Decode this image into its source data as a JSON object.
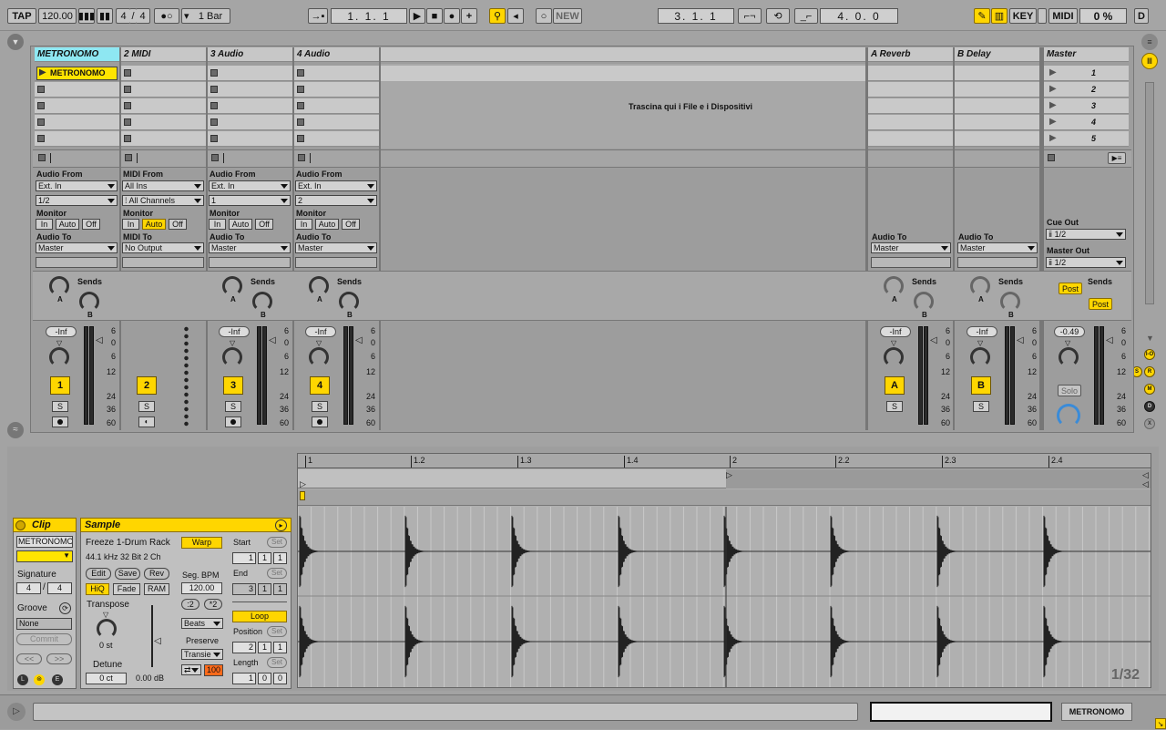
{
  "transport": {
    "tap": "TAP",
    "tempo": "120.00",
    "signature_num": "4",
    "signature_den": "4",
    "quantize": "1 Bar",
    "position": "1.   1.   1",
    "new": "NEW",
    "loop_start": "3.   1.   1",
    "loop_length": "4.   0.   0",
    "key": "KEY",
    "midi": "MIDI",
    "cpu": "0 %",
    "disk": "D"
  },
  "tracks": [
    {
      "name": "METRONOMO",
      "clip": "METRONOMO",
      "number": "1"
    },
    {
      "name": "2 MIDI",
      "number": "2"
    },
    {
      "name": "3 Audio",
      "number": "3"
    },
    {
      "name": "4 Audio",
      "number": "4"
    }
  ],
  "returns": [
    {
      "name": "A Reverb",
      "letter": "A"
    },
    {
      "name": "B Delay",
      "letter": "B"
    }
  ],
  "master": {
    "name": "Master",
    "scenes": [
      "1",
      "2",
      "3",
      "4",
      "5"
    ],
    "cue_out_label": "Cue Out",
    "cue_out": "1/2",
    "master_out_label": "Master Out",
    "master_out": "1/2",
    "post": "Post",
    "volume": "-0.49",
    "solo": "Solo"
  },
  "drop_hint": "Trascina qui i File e i Dispositivi",
  "io": {
    "audio_from": "Audio From",
    "midi_from": "MIDI From",
    "monitor": "Monitor",
    "audio_to": "Audio To",
    "midi_to": "MIDI To",
    "in": "In",
    "auto": "Auto",
    "off": "Off",
    "ext_in": "Ext. In",
    "all_ins": "All Ins",
    "all_channels": "All Channels",
    "ch1": "1/2",
    "ch3": "1",
    "ch4": "2",
    "master": "Master",
    "no_output": "No Output"
  },
  "mixer": {
    "sends": "Sends",
    "send_a": "A",
    "send_b": "B",
    "inf": "-Inf",
    "solo_s": "S",
    "scale": [
      "6",
      "0",
      "6",
      "12",
      "24",
      "36",
      "60"
    ]
  },
  "clip_panel": {
    "title": "Clip",
    "name": "METRONOMO",
    "signature_label": "Signature",
    "sig_num": "4",
    "sig_den": "4",
    "groove_label": "Groove",
    "groove": "None",
    "commit": "Commit",
    "prev": "<<",
    "next": ">>"
  },
  "sample_panel": {
    "title": "Sample",
    "name": "Freeze 1-Drum Rack",
    "info": "44.1 kHz 32 Bit 2 Ch",
    "edit": "Edit",
    "save": "Save",
    "rev": "Rev",
    "hiq": "HiQ",
    "fade": "Fade",
    "ram": "RAM",
    "transpose": "Transpose",
    "transpose_val": "0 st",
    "detune": "Detune",
    "detune_val": "0 ct",
    "gain": "0.00 dB",
    "warp": "Warp",
    "seg_bpm_label": "Seg. BPM",
    "seg_bpm": "120.00",
    "half": ":2",
    "double": "*2",
    "warp_mode": "Beats",
    "preserve_label": "Preserve",
    "preserve": "Transie",
    "envelope": "100",
    "start": "Start",
    "end": "End",
    "loop": "Loop",
    "position": "Position",
    "length": "Length",
    "set": "Set",
    "start_vals": [
      "1",
      "1",
      "1"
    ],
    "end_vals": [
      "3",
      "1",
      "1"
    ],
    "pos_vals": [
      "2",
      "1",
      "1"
    ],
    "len_vals": [
      "1",
      "0",
      "0"
    ]
  },
  "ruler": [
    "1",
    "1.2",
    "1.3",
    "1.4",
    "2",
    "2.2",
    "2.3",
    "2.4"
  ],
  "zoom": "1/32",
  "status_track": "METRONOMO",
  "side_icons": [
    "I-O",
    "S",
    "R",
    "M",
    "D",
    "X"
  ]
}
